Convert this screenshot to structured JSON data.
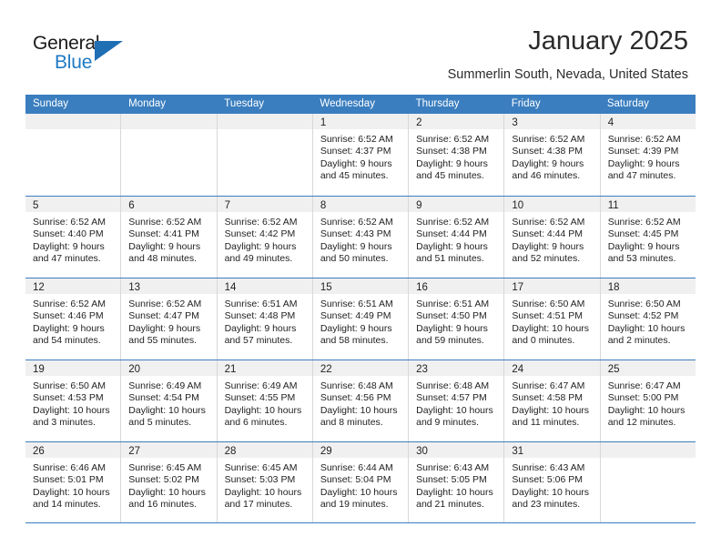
{
  "brand": {
    "word1": "General",
    "word2": "Blue",
    "flag_icon": "triangle-flag-icon",
    "accent_color": "#1f6fb5"
  },
  "header": {
    "month_title": "January 2025",
    "location": "Summerlin South, Nevada, United States"
  },
  "calendar": {
    "header_bg": "#3a7ebf",
    "datebar_bg": "#f0f0f0",
    "weekdays": [
      "Sunday",
      "Monday",
      "Tuesday",
      "Wednesday",
      "Thursday",
      "Friday",
      "Saturday"
    ],
    "weeks": [
      [
        {
          "empty": true
        },
        {
          "empty": true
        },
        {
          "empty": true
        },
        {
          "day": "1",
          "sunrise": "Sunrise: 6:52 AM",
          "sunset": "Sunset: 4:37 PM",
          "daylight_line1": "Daylight: 9 hours",
          "daylight_line2": "and 45 minutes."
        },
        {
          "day": "2",
          "sunrise": "Sunrise: 6:52 AM",
          "sunset": "Sunset: 4:38 PM",
          "daylight_line1": "Daylight: 9 hours",
          "daylight_line2": "and 45 minutes."
        },
        {
          "day": "3",
          "sunrise": "Sunrise: 6:52 AM",
          "sunset": "Sunset: 4:38 PM",
          "daylight_line1": "Daylight: 9 hours",
          "daylight_line2": "and 46 minutes."
        },
        {
          "day": "4",
          "sunrise": "Sunrise: 6:52 AM",
          "sunset": "Sunset: 4:39 PM",
          "daylight_line1": "Daylight: 9 hours",
          "daylight_line2": "and 47 minutes."
        }
      ],
      [
        {
          "day": "5",
          "sunrise": "Sunrise: 6:52 AM",
          "sunset": "Sunset: 4:40 PM",
          "daylight_line1": "Daylight: 9 hours",
          "daylight_line2": "and 47 minutes."
        },
        {
          "day": "6",
          "sunrise": "Sunrise: 6:52 AM",
          "sunset": "Sunset: 4:41 PM",
          "daylight_line1": "Daylight: 9 hours",
          "daylight_line2": "and 48 minutes."
        },
        {
          "day": "7",
          "sunrise": "Sunrise: 6:52 AM",
          "sunset": "Sunset: 4:42 PM",
          "daylight_line1": "Daylight: 9 hours",
          "daylight_line2": "and 49 minutes."
        },
        {
          "day": "8",
          "sunrise": "Sunrise: 6:52 AM",
          "sunset": "Sunset: 4:43 PM",
          "daylight_line1": "Daylight: 9 hours",
          "daylight_line2": "and 50 minutes."
        },
        {
          "day": "9",
          "sunrise": "Sunrise: 6:52 AM",
          "sunset": "Sunset: 4:44 PM",
          "daylight_line1": "Daylight: 9 hours",
          "daylight_line2": "and 51 minutes."
        },
        {
          "day": "10",
          "sunrise": "Sunrise: 6:52 AM",
          "sunset": "Sunset: 4:44 PM",
          "daylight_line1": "Daylight: 9 hours",
          "daylight_line2": "and 52 minutes."
        },
        {
          "day": "11",
          "sunrise": "Sunrise: 6:52 AM",
          "sunset": "Sunset: 4:45 PM",
          "daylight_line1": "Daylight: 9 hours",
          "daylight_line2": "and 53 minutes."
        }
      ],
      [
        {
          "day": "12",
          "sunrise": "Sunrise: 6:52 AM",
          "sunset": "Sunset: 4:46 PM",
          "daylight_line1": "Daylight: 9 hours",
          "daylight_line2": "and 54 minutes."
        },
        {
          "day": "13",
          "sunrise": "Sunrise: 6:52 AM",
          "sunset": "Sunset: 4:47 PM",
          "daylight_line1": "Daylight: 9 hours",
          "daylight_line2": "and 55 minutes."
        },
        {
          "day": "14",
          "sunrise": "Sunrise: 6:51 AM",
          "sunset": "Sunset: 4:48 PM",
          "daylight_line1": "Daylight: 9 hours",
          "daylight_line2": "and 57 minutes."
        },
        {
          "day": "15",
          "sunrise": "Sunrise: 6:51 AM",
          "sunset": "Sunset: 4:49 PM",
          "daylight_line1": "Daylight: 9 hours",
          "daylight_line2": "and 58 minutes."
        },
        {
          "day": "16",
          "sunrise": "Sunrise: 6:51 AM",
          "sunset": "Sunset: 4:50 PM",
          "daylight_line1": "Daylight: 9 hours",
          "daylight_line2": "and 59 minutes."
        },
        {
          "day": "17",
          "sunrise": "Sunrise: 6:50 AM",
          "sunset": "Sunset: 4:51 PM",
          "daylight_line1": "Daylight: 10 hours",
          "daylight_line2": "and 0 minutes."
        },
        {
          "day": "18",
          "sunrise": "Sunrise: 6:50 AM",
          "sunset": "Sunset: 4:52 PM",
          "daylight_line1": "Daylight: 10 hours",
          "daylight_line2": "and 2 minutes."
        }
      ],
      [
        {
          "day": "19",
          "sunrise": "Sunrise: 6:50 AM",
          "sunset": "Sunset: 4:53 PM",
          "daylight_line1": "Daylight: 10 hours",
          "daylight_line2": "and 3 minutes."
        },
        {
          "day": "20",
          "sunrise": "Sunrise: 6:49 AM",
          "sunset": "Sunset: 4:54 PM",
          "daylight_line1": "Daylight: 10 hours",
          "daylight_line2": "and 5 minutes."
        },
        {
          "day": "21",
          "sunrise": "Sunrise: 6:49 AM",
          "sunset": "Sunset: 4:55 PM",
          "daylight_line1": "Daylight: 10 hours",
          "daylight_line2": "and 6 minutes."
        },
        {
          "day": "22",
          "sunrise": "Sunrise: 6:48 AM",
          "sunset": "Sunset: 4:56 PM",
          "daylight_line1": "Daylight: 10 hours",
          "daylight_line2": "and 8 minutes."
        },
        {
          "day": "23",
          "sunrise": "Sunrise: 6:48 AM",
          "sunset": "Sunset: 4:57 PM",
          "daylight_line1": "Daylight: 10 hours",
          "daylight_line2": "and 9 minutes."
        },
        {
          "day": "24",
          "sunrise": "Sunrise: 6:47 AM",
          "sunset": "Sunset: 4:58 PM",
          "daylight_line1": "Daylight: 10 hours",
          "daylight_line2": "and 11 minutes."
        },
        {
          "day": "25",
          "sunrise": "Sunrise: 6:47 AM",
          "sunset": "Sunset: 5:00 PM",
          "daylight_line1": "Daylight: 10 hours",
          "daylight_line2": "and 12 minutes."
        }
      ],
      [
        {
          "day": "26",
          "sunrise": "Sunrise: 6:46 AM",
          "sunset": "Sunset: 5:01 PM",
          "daylight_line1": "Daylight: 10 hours",
          "daylight_line2": "and 14 minutes."
        },
        {
          "day": "27",
          "sunrise": "Sunrise: 6:45 AM",
          "sunset": "Sunset: 5:02 PM",
          "daylight_line1": "Daylight: 10 hours",
          "daylight_line2": "and 16 minutes."
        },
        {
          "day": "28",
          "sunrise": "Sunrise: 6:45 AM",
          "sunset": "Sunset: 5:03 PM",
          "daylight_line1": "Daylight: 10 hours",
          "daylight_line2": "and 17 minutes."
        },
        {
          "day": "29",
          "sunrise": "Sunrise: 6:44 AM",
          "sunset": "Sunset: 5:04 PM",
          "daylight_line1": "Daylight: 10 hours",
          "daylight_line2": "and 19 minutes."
        },
        {
          "day": "30",
          "sunrise": "Sunrise: 6:43 AM",
          "sunset": "Sunset: 5:05 PM",
          "daylight_line1": "Daylight: 10 hours",
          "daylight_line2": "and 21 minutes."
        },
        {
          "day": "31",
          "sunrise": "Sunrise: 6:43 AM",
          "sunset": "Sunset: 5:06 PM",
          "daylight_line1": "Daylight: 10 hours",
          "daylight_line2": "and 23 minutes."
        },
        {
          "empty": true
        }
      ]
    ]
  }
}
